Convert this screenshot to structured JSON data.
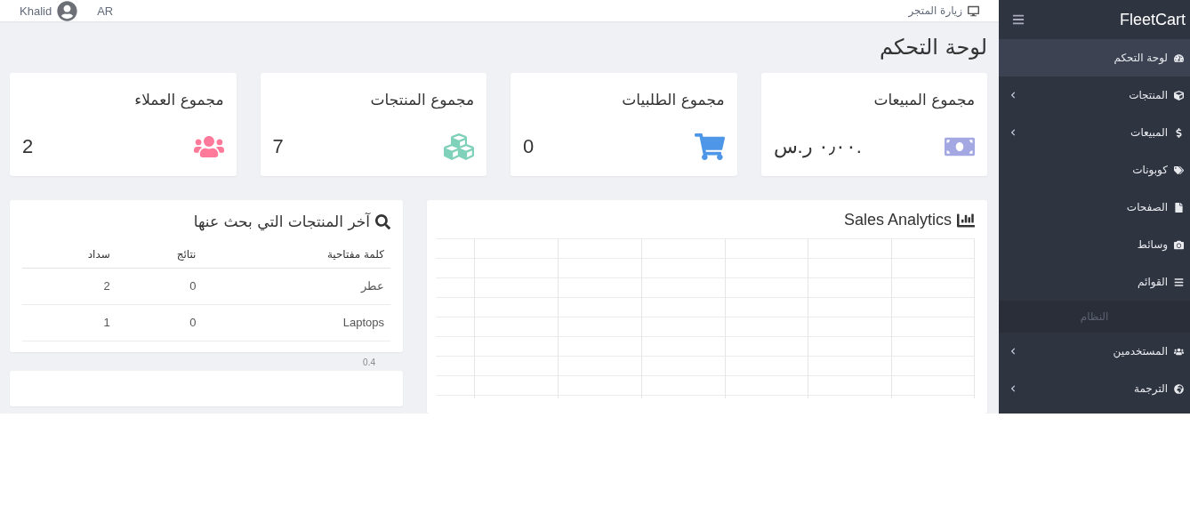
{
  "topbar": {
    "visit_store": "زيارة المتجر",
    "user": "Khalid",
    "language": "AR"
  },
  "sidebar": {
    "brand": "FleetCart",
    "items": [
      {
        "kind": "link",
        "label": "لوحة التحكم",
        "selected": true,
        "expandable": false
      },
      {
        "kind": "link",
        "label": "المنتجات",
        "selected": false,
        "expandable": true
      },
      {
        "kind": "link",
        "label": "المبيعات",
        "selected": false,
        "expandable": true
      },
      {
        "kind": "link",
        "label": "كوبونات",
        "selected": false,
        "expandable": false
      },
      {
        "kind": "link",
        "label": "الصفحات",
        "selected": false,
        "expandable": false
      },
      {
        "kind": "link",
        "label": "وسائط",
        "selected": false,
        "expandable": false
      },
      {
        "kind": "link",
        "label": "القوائم",
        "selected": false,
        "expandable": false
      },
      {
        "kind": "header",
        "label": "النظام"
      },
      {
        "kind": "link",
        "label": "المستخدمين",
        "selected": false,
        "expandable": true
      },
      {
        "kind": "link",
        "label": "الترجمة",
        "selected": false,
        "expandable": true
      }
    ]
  },
  "page_title": "لوحة التحكم",
  "stats": [
    {
      "title": "مجموع المبيعات",
      "value": "٠٫٠٠ ر.س.",
      "color": "#a3a8e3"
    },
    {
      "title": "مجموع الطلبيات",
      "value": "0",
      "color": "#4e97e8"
    },
    {
      "title": "مجموع المنتجات",
      "value": "7",
      "color": "#7fd1b9"
    },
    {
      "title": "مجموع العملاء",
      "value": "2",
      "color": "#ff7a9a"
    }
  ],
  "sales_analytics": {
    "title": "Sales Analytics"
  },
  "searches": {
    "title": "آخر المنتجات التي بحث عنها",
    "columns": [
      "كلمة مفتاحية",
      "نتائج",
      "سداد"
    ],
    "rows": [
      [
        "عطر",
        "0",
        "2"
      ],
      [
        "Laptops",
        "0",
        "1"
      ]
    ]
  },
  "chart_axis_label": "0.4"
}
